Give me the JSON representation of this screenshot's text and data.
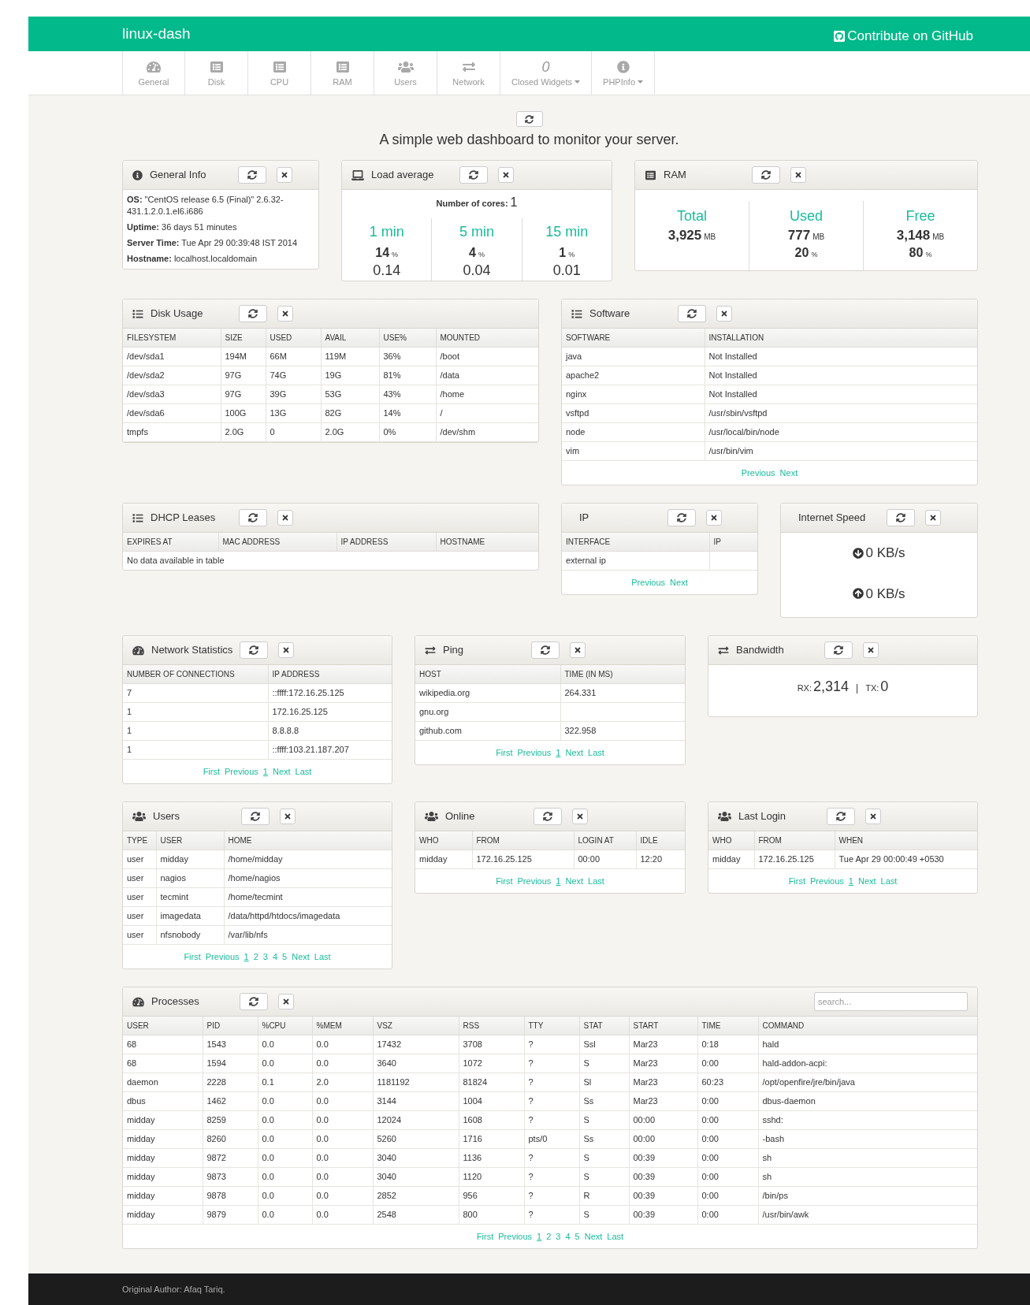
{
  "header": {
    "title": "linux-dash",
    "github_link": "Contribute on GitHub"
  },
  "nav": [
    {
      "label": "General",
      "kind": "icon",
      "dropdown": false
    },
    {
      "label": "Disk",
      "kind": "icon",
      "dropdown": false
    },
    {
      "label": "CPU",
      "kind": "icon",
      "dropdown": false
    },
    {
      "label": "RAM",
      "kind": "icon",
      "dropdown": false
    },
    {
      "label": "Users",
      "kind": "icon",
      "dropdown": false
    },
    {
      "label": "Network",
      "kind": "icon",
      "dropdown": false
    },
    {
      "label": "Closed Widgets",
      "kind": "count",
      "count": "0",
      "dropdown": true
    },
    {
      "label": "PHPInfo",
      "kind": "icon",
      "dropdown": true
    }
  ],
  "tagline": "A simple web dashboard to monitor your server.",
  "general_info": {
    "title": "General Info",
    "lines": [
      "**OS:** \"CentOS release 6.5 (Final)\" 2.6.32-431.1.2.0.1.el6.i686",
      "**Uptime:** 36 days 51 minutes",
      "**Server Time:** Tue Apr 29 00:39:48 IST 2014",
      "**Hostname:** localhost.localdomain"
    ]
  },
  "load_average": {
    "title": "Load average",
    "cores_label": "Number of cores:",
    "cores": "1",
    "periods": [
      {
        "label": "1 min",
        "percent": "14",
        "percent_unit": "%",
        "value": "0.14"
      },
      {
        "label": "5 min",
        "percent": "4",
        "percent_unit": "%",
        "value": "0.04"
      },
      {
        "label": "15 min",
        "percent": "1",
        "percent_unit": "%",
        "value": "0.01"
      }
    ]
  },
  "ram": {
    "title": "RAM",
    "stats": [
      {
        "label": "Total",
        "value": "3,925",
        "unit": "MB"
      },
      {
        "label": "Used",
        "value": "777",
        "unit": "MB",
        "percent": "20",
        "percent_unit": "%"
      },
      {
        "label": "Free",
        "value": "3,148",
        "unit": "MB",
        "percent": "80",
        "percent_unit": "%"
      }
    ]
  },
  "disk_usage": {
    "title": "Disk Usage",
    "columns": [
      "FILESYSTEM",
      "SIZE",
      "USED",
      "AVAIL",
      "USE%",
      "MOUNTED"
    ],
    "rows": [
      [
        "/dev/sda1",
        "194M",
        "66M",
        "119M",
        "36%",
        "/boot"
      ],
      [
        "/dev/sda2",
        "97G",
        "74G",
        "19G",
        "81%",
        "/data"
      ],
      [
        "/dev/sda3",
        "97G",
        "39G",
        "53G",
        "43%",
        "/home"
      ],
      [
        "/dev/sda6",
        "100G",
        "13G",
        "82G",
        "14%",
        "/"
      ],
      [
        "tmpfs",
        "2.0G",
        "0",
        "2.0G",
        "0%",
        "/dev/shm"
      ]
    ]
  },
  "software": {
    "title": "Software",
    "columns": [
      "SOFTWARE",
      "INSTALLATION"
    ],
    "rows": [
      [
        "java",
        "Not Installed"
      ],
      [
        "apache2",
        "Not Installed"
      ],
      [
        "nginx",
        "Not Installed"
      ],
      [
        "vsftpd",
        "/usr/sbin/vsftpd"
      ],
      [
        "node",
        "/usr/local/bin/node"
      ],
      [
        "vim",
        "/usr/bin/vim"
      ]
    ],
    "pagination": [
      {
        "label": "Previous",
        "selected": false
      },
      {
        "label": "Next",
        "selected": false
      }
    ]
  },
  "dhcp_leases": {
    "title": "DHCP Leases",
    "columns": [
      "EXPIRES AT",
      "MAC ADDRESS",
      "IP ADDRESS",
      "HOSTNAME"
    ],
    "empty_message": "No data available in table"
  },
  "ip": {
    "title": "IP",
    "columns": [
      "INTERFACE",
      "IP"
    ],
    "rows": [
      [
        "external ip",
        null
      ]
    ],
    "pagination": [
      {
        "label": "Previous",
        "selected": false
      },
      {
        "label": "Next",
        "selected": false
      }
    ]
  },
  "internet_speed": {
    "title": "Internet Speed",
    "download": "0 KB/s",
    "upload": "0 KB/s"
  },
  "network_statistics": {
    "title": "Network Statistics",
    "columns": [
      "NUMBER OF CONNECTIONS",
      "IP ADDRESS"
    ],
    "rows": [
      [
        "7",
        "::ffff:172.16.25.125"
      ],
      [
        "1",
        "172.16.25.125"
      ],
      [
        "1",
        "8.8.8.8"
      ],
      [
        "1",
        "::ffff:103.21.187.207"
      ]
    ],
    "pagination": [
      {
        "label": "First",
        "selected": false
      },
      {
        "label": "Previous",
        "selected": false
      },
      {
        "label": "1",
        "selected": true
      },
      {
        "label": "Next",
        "selected": false
      },
      {
        "label": "Last",
        "selected": false
      }
    ]
  },
  "ping": {
    "title": "Ping",
    "columns": [
      "HOST",
      "TIME (IN MS)"
    ],
    "rows": [
      [
        "wikipedia.org",
        "264.331"
      ],
      [
        "gnu.org",
        null
      ],
      [
        "github.com",
        "322.958"
      ]
    ],
    "pagination": [
      {
        "label": "First",
        "selected": false
      },
      {
        "label": "Previous",
        "selected": false
      },
      {
        "label": "1",
        "selected": true
      },
      {
        "label": "Next",
        "selected": false
      },
      {
        "label": "Last",
        "selected": false
      }
    ]
  },
  "bandwidth": {
    "title": "Bandwidth",
    "rx_label": "RX:",
    "rx": "2,314",
    "separator": "|",
    "tx_label": "TX:",
    "tx": "0"
  },
  "users": {
    "title": "Users",
    "columns": [
      "TYPE",
      "USER",
      "HOME"
    ],
    "rows": [
      [
        "user",
        "midday",
        "/home/midday"
      ],
      [
        "user",
        "nagios",
        "/home/nagios"
      ],
      [
        "user",
        "tecmint",
        "/home/tecmint"
      ],
      [
        "user",
        "imagedata",
        "/data/httpd/htdocs/imagedata"
      ],
      [
        "user",
        "nfsnobody",
        "/var/lib/nfs"
      ]
    ],
    "pagination": [
      {
        "label": "First",
        "selected": false
      },
      {
        "label": "Previous",
        "selected": false
      },
      {
        "label": "1",
        "selected": true
      },
      {
        "label": "2",
        "selected": false
      },
      {
        "label": "3",
        "selected": false
      },
      {
        "label": "4",
        "selected": false
      },
      {
        "label": "5",
        "selected": false
      },
      {
        "label": "Next",
        "selected": false
      },
      {
        "label": "Last",
        "selected": false
      }
    ]
  },
  "online": {
    "title": "Online",
    "columns": [
      "WHO",
      "FROM",
      "LOGIN AT",
      "IDLE"
    ],
    "rows": [
      [
        "midday",
        "172.16.25.125",
        "00:00",
        "12:20"
      ]
    ],
    "pagination": [
      {
        "label": "First",
        "selected": false
      },
      {
        "label": "Previous",
        "selected": false
      },
      {
        "label": "1",
        "selected": true
      },
      {
        "label": "Next",
        "selected": false
      },
      {
        "label": "Last",
        "selected": false
      }
    ]
  },
  "last_login": {
    "title": "Last Login",
    "columns": [
      "WHO",
      "FROM",
      "WHEN"
    ],
    "rows": [
      [
        "midday",
        "172.16.25.125",
        "Tue Apr 29 00:00:49 +0530"
      ]
    ],
    "pagination": [
      {
        "label": "First",
        "selected": false
      },
      {
        "label": "Previous",
        "selected": false
      },
      {
        "label": "1",
        "selected": true
      },
      {
        "label": "Next",
        "selected": false
      },
      {
        "label": "Last",
        "selected": false
      }
    ]
  },
  "processes": {
    "title": "Processes",
    "search": {
      "placeholder": "search..."
    },
    "columns": [
      "USER",
      "PID",
      "%CPU",
      "%MEM",
      "VSZ",
      "RSS",
      "TTY",
      "STAT",
      "START",
      "TIME",
      "COMMAND"
    ],
    "rows": [
      [
        "68",
        "1543",
        "0.0",
        "0.0",
        "17432",
        "3708",
        "?",
        "Ssl",
        "Mar23",
        "0:18",
        "hald"
      ],
      [
        "68",
        "1594",
        "0.0",
        "0.0",
        "3640",
        "1072",
        "?",
        "S",
        "Mar23",
        "0:00",
        "hald-addon-acpi:"
      ],
      [
        "daemon",
        "2228",
        "0.1",
        "2.0",
        "1181192",
        "81824",
        "?",
        "Sl",
        "Mar23",
        "60:23",
        "/opt/openfire/jre/bin/java"
      ],
      [
        "dbus",
        "1462",
        "0.0",
        "0.0",
        "3144",
        "1004",
        "?",
        "Ss",
        "Mar23",
        "0:00",
        "dbus-daemon"
      ],
      [
        "midday",
        "8259",
        "0.0",
        "0.0",
        "12024",
        "1608",
        "?",
        "S",
        "00:00",
        "0:00",
        "sshd:"
      ],
      [
        "midday",
        "8260",
        "0.0",
        "0.0",
        "5260",
        "1716",
        "pts/0",
        "Ss",
        "00:00",
        "0:00",
        "-bash"
      ],
      [
        "midday",
        "9872",
        "0.0",
        "0.0",
        "3040",
        "1136",
        "?",
        "S",
        "00:39",
        "0:00",
        "sh"
      ],
      [
        "midday",
        "9873",
        "0.0",
        "0.0",
        "3040",
        "1120",
        "?",
        "S",
        "00:39",
        "0:00",
        "sh"
      ],
      [
        "midday",
        "9878",
        "0.0",
        "0.0",
        "2852",
        "956",
        "?",
        "R",
        "00:39",
        "0:00",
        "/bin/ps"
      ],
      [
        "midday",
        "9879",
        "0.0",
        "0.0",
        "2548",
        "800",
        "?",
        "S",
        "00:39",
        "0:00",
        "/usr/bin/awk"
      ]
    ],
    "pagination": [
      {
        "label": "First",
        "selected": false
      },
      {
        "label": "Previous",
        "selected": false
      },
      {
        "label": "1",
        "selected": true
      },
      {
        "label": "2",
        "selected": false
      },
      {
        "label": "3",
        "selected": false
      },
      {
        "label": "4",
        "selected": false
      },
      {
        "label": "5",
        "selected": false
      },
      {
        "label": "Next",
        "selected": false
      },
      {
        "label": "Last",
        "selected": false
      }
    ]
  },
  "footer": {
    "text": "Original Author: Afaq Tariq."
  }
}
